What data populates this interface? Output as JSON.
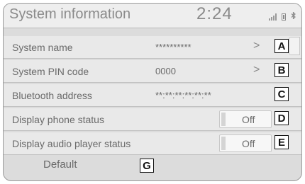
{
  "header": {
    "title": "System information",
    "clock": "2:24",
    "icons": [
      "signal-icon",
      "battery-icon",
      "bluetooth-icon"
    ]
  },
  "rows": [
    {
      "label": "System name",
      "value": "**********",
      "tag": "A"
    },
    {
      "label": "System PIN code",
      "value": "0000",
      "tag": "B"
    },
    {
      "label": "Bluetooth address",
      "value": "**:**:**:**:**:**",
      "tag": "C"
    },
    {
      "label": "Display phone status",
      "value": "Off",
      "tag": "D"
    },
    {
      "label": "Display audio player status",
      "value": "Off",
      "tag": "E"
    }
  ],
  "chevron": ">",
  "bluetooth_glyph": "ʙ",
  "default_button": {
    "label": "Default",
    "tag": "G"
  }
}
